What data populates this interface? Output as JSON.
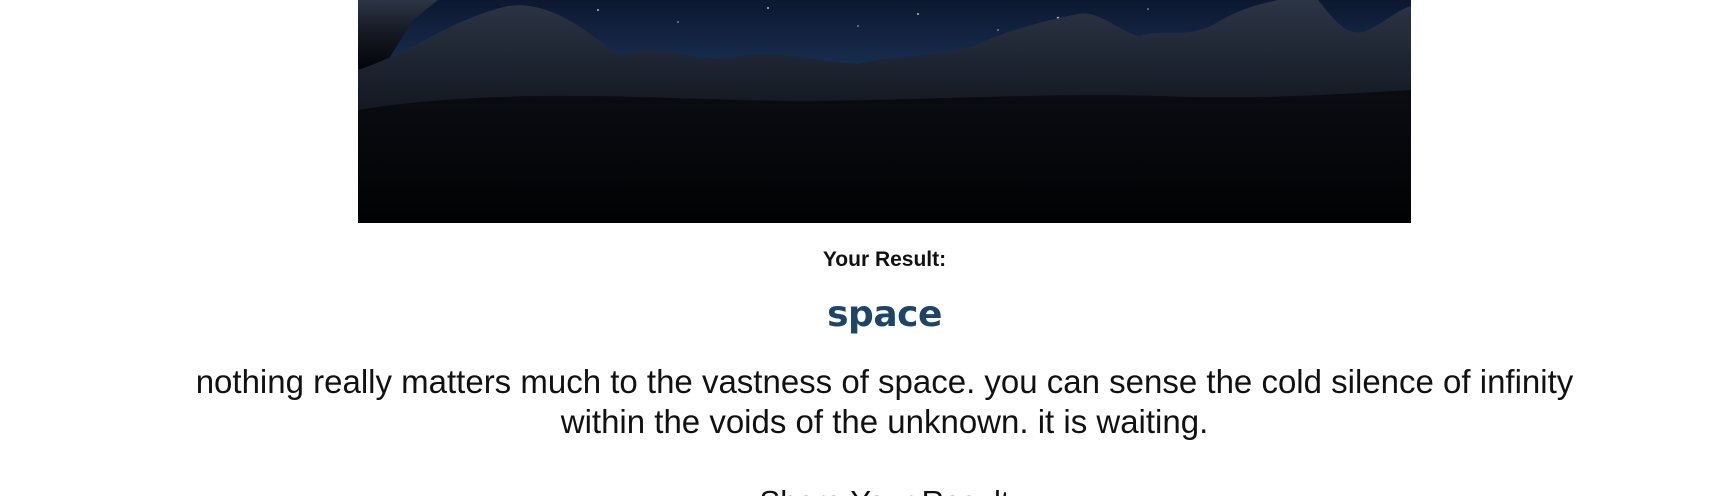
{
  "hero": {
    "image_name": "night-mountain-landscape",
    "colors": {
      "sky_top": "#0d1830",
      "sky_glow": "#2e5688",
      "ground": "#020305"
    }
  },
  "result": {
    "label": "Your Result:",
    "title": "space",
    "description": "nothing really matters much to the vastness of space. you can sense the cold silence of infinity within the voids of the unknown. it is waiting."
  },
  "share": {
    "label": "Share Your Result"
  }
}
